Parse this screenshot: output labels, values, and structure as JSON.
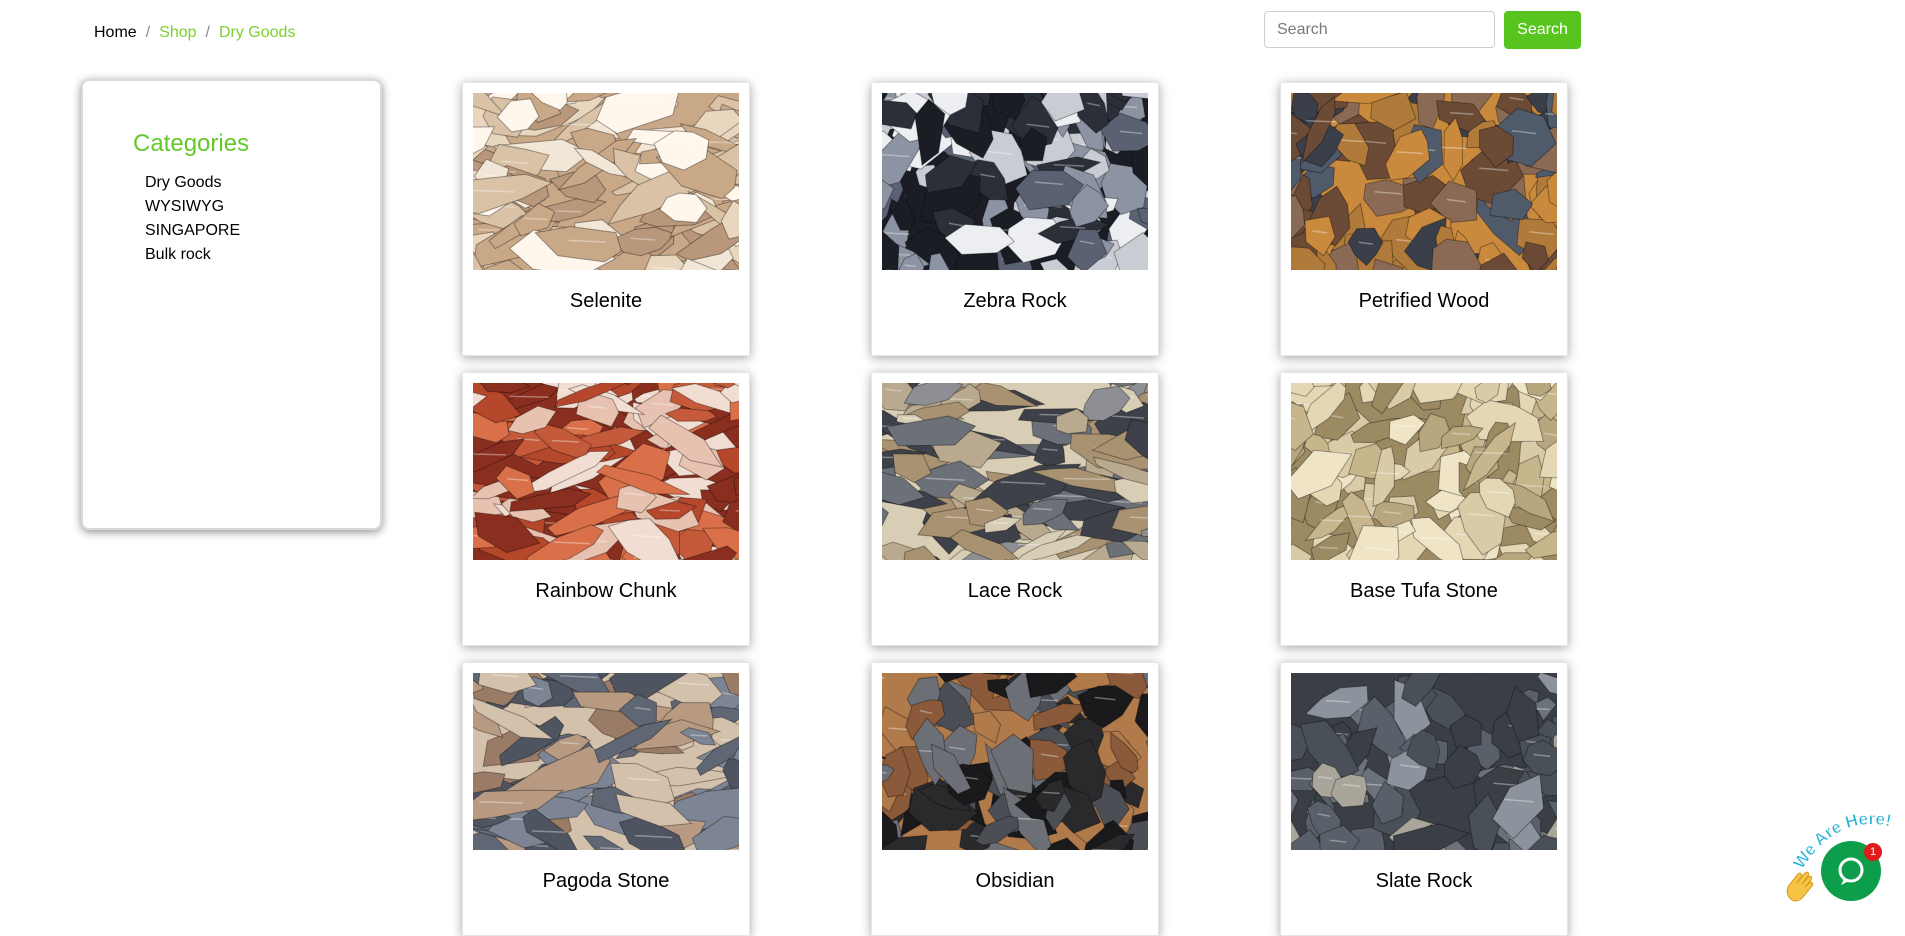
{
  "breadcrumb": {
    "home": "Home",
    "shop": "Shop",
    "current": "Dry Goods"
  },
  "search": {
    "placeholder": "Search",
    "button_label": "Search"
  },
  "sidebar": {
    "title": "Categories",
    "items": [
      "Dry Goods",
      "WYSIWYG",
      "SINGAPORE",
      "Bulk rock"
    ]
  },
  "products": [
    {
      "name": "Selenite"
    },
    {
      "name": "Zebra Rock"
    },
    {
      "name": "Petrified Wood"
    },
    {
      "name": "Rainbow Chunk"
    },
    {
      "name": "Lace Rock"
    },
    {
      "name": "Base Tufa Stone"
    },
    {
      "name": "Pagoda Stone"
    },
    {
      "name": "Obsidian"
    },
    {
      "name": "Slate Rock"
    }
  ],
  "chat": {
    "badge_count": "1",
    "banner_text": "We Are Here!"
  },
  "colors": {
    "accent": "#57c51d",
    "category_title": "#63c92a",
    "link": "#7ccf2f",
    "chat": "#0d9e4b"
  }
}
